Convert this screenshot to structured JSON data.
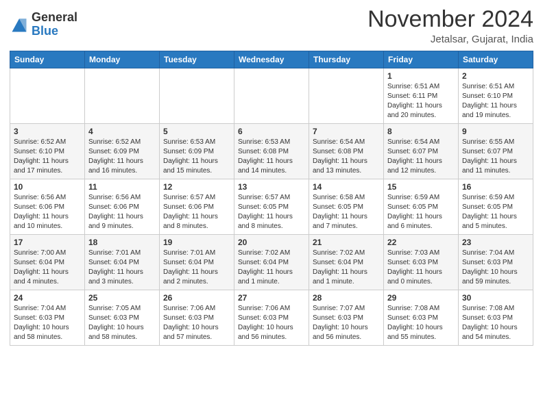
{
  "header": {
    "logo_general": "General",
    "logo_blue": "Blue",
    "month_title": "November 2024",
    "location": "Jetalsar, Gujarat, India"
  },
  "weekdays": [
    "Sunday",
    "Monday",
    "Tuesday",
    "Wednesday",
    "Thursday",
    "Friday",
    "Saturday"
  ],
  "weeks": [
    [
      {
        "day": "",
        "info": ""
      },
      {
        "day": "",
        "info": ""
      },
      {
        "day": "",
        "info": ""
      },
      {
        "day": "",
        "info": ""
      },
      {
        "day": "",
        "info": ""
      },
      {
        "day": "1",
        "info": "Sunrise: 6:51 AM\nSunset: 6:11 PM\nDaylight: 11 hours\nand 20 minutes."
      },
      {
        "day": "2",
        "info": "Sunrise: 6:51 AM\nSunset: 6:10 PM\nDaylight: 11 hours\nand 19 minutes."
      }
    ],
    [
      {
        "day": "3",
        "info": "Sunrise: 6:52 AM\nSunset: 6:10 PM\nDaylight: 11 hours\nand 17 minutes."
      },
      {
        "day": "4",
        "info": "Sunrise: 6:52 AM\nSunset: 6:09 PM\nDaylight: 11 hours\nand 16 minutes."
      },
      {
        "day": "5",
        "info": "Sunrise: 6:53 AM\nSunset: 6:09 PM\nDaylight: 11 hours\nand 15 minutes."
      },
      {
        "day": "6",
        "info": "Sunrise: 6:53 AM\nSunset: 6:08 PM\nDaylight: 11 hours\nand 14 minutes."
      },
      {
        "day": "7",
        "info": "Sunrise: 6:54 AM\nSunset: 6:08 PM\nDaylight: 11 hours\nand 13 minutes."
      },
      {
        "day": "8",
        "info": "Sunrise: 6:54 AM\nSunset: 6:07 PM\nDaylight: 11 hours\nand 12 minutes."
      },
      {
        "day": "9",
        "info": "Sunrise: 6:55 AM\nSunset: 6:07 PM\nDaylight: 11 hours\nand 11 minutes."
      }
    ],
    [
      {
        "day": "10",
        "info": "Sunrise: 6:56 AM\nSunset: 6:06 PM\nDaylight: 11 hours\nand 10 minutes."
      },
      {
        "day": "11",
        "info": "Sunrise: 6:56 AM\nSunset: 6:06 PM\nDaylight: 11 hours\nand 9 minutes."
      },
      {
        "day": "12",
        "info": "Sunrise: 6:57 AM\nSunset: 6:06 PM\nDaylight: 11 hours\nand 8 minutes."
      },
      {
        "day": "13",
        "info": "Sunrise: 6:57 AM\nSunset: 6:05 PM\nDaylight: 11 hours\nand 8 minutes."
      },
      {
        "day": "14",
        "info": "Sunrise: 6:58 AM\nSunset: 6:05 PM\nDaylight: 11 hours\nand 7 minutes."
      },
      {
        "day": "15",
        "info": "Sunrise: 6:59 AM\nSunset: 6:05 PM\nDaylight: 11 hours\nand 6 minutes."
      },
      {
        "day": "16",
        "info": "Sunrise: 6:59 AM\nSunset: 6:05 PM\nDaylight: 11 hours\nand 5 minutes."
      }
    ],
    [
      {
        "day": "17",
        "info": "Sunrise: 7:00 AM\nSunset: 6:04 PM\nDaylight: 11 hours\nand 4 minutes."
      },
      {
        "day": "18",
        "info": "Sunrise: 7:01 AM\nSunset: 6:04 PM\nDaylight: 11 hours\nand 3 minutes."
      },
      {
        "day": "19",
        "info": "Sunrise: 7:01 AM\nSunset: 6:04 PM\nDaylight: 11 hours\nand 2 minutes."
      },
      {
        "day": "20",
        "info": "Sunrise: 7:02 AM\nSunset: 6:04 PM\nDaylight: 11 hours\nand 1 minute."
      },
      {
        "day": "21",
        "info": "Sunrise: 7:02 AM\nSunset: 6:04 PM\nDaylight: 11 hours\nand 1 minute."
      },
      {
        "day": "22",
        "info": "Sunrise: 7:03 AM\nSunset: 6:03 PM\nDaylight: 11 hours\nand 0 minutes."
      },
      {
        "day": "23",
        "info": "Sunrise: 7:04 AM\nSunset: 6:03 PM\nDaylight: 10 hours\nand 59 minutes."
      }
    ],
    [
      {
        "day": "24",
        "info": "Sunrise: 7:04 AM\nSunset: 6:03 PM\nDaylight: 10 hours\nand 58 minutes."
      },
      {
        "day": "25",
        "info": "Sunrise: 7:05 AM\nSunset: 6:03 PM\nDaylight: 10 hours\nand 58 minutes."
      },
      {
        "day": "26",
        "info": "Sunrise: 7:06 AM\nSunset: 6:03 PM\nDaylight: 10 hours\nand 57 minutes."
      },
      {
        "day": "27",
        "info": "Sunrise: 7:06 AM\nSunset: 6:03 PM\nDaylight: 10 hours\nand 56 minutes."
      },
      {
        "day": "28",
        "info": "Sunrise: 7:07 AM\nSunset: 6:03 PM\nDaylight: 10 hours\nand 56 minutes."
      },
      {
        "day": "29",
        "info": "Sunrise: 7:08 AM\nSunset: 6:03 PM\nDaylight: 10 hours\nand 55 minutes."
      },
      {
        "day": "30",
        "info": "Sunrise: 7:08 AM\nSunset: 6:03 PM\nDaylight: 10 hours\nand 54 minutes."
      }
    ]
  ]
}
